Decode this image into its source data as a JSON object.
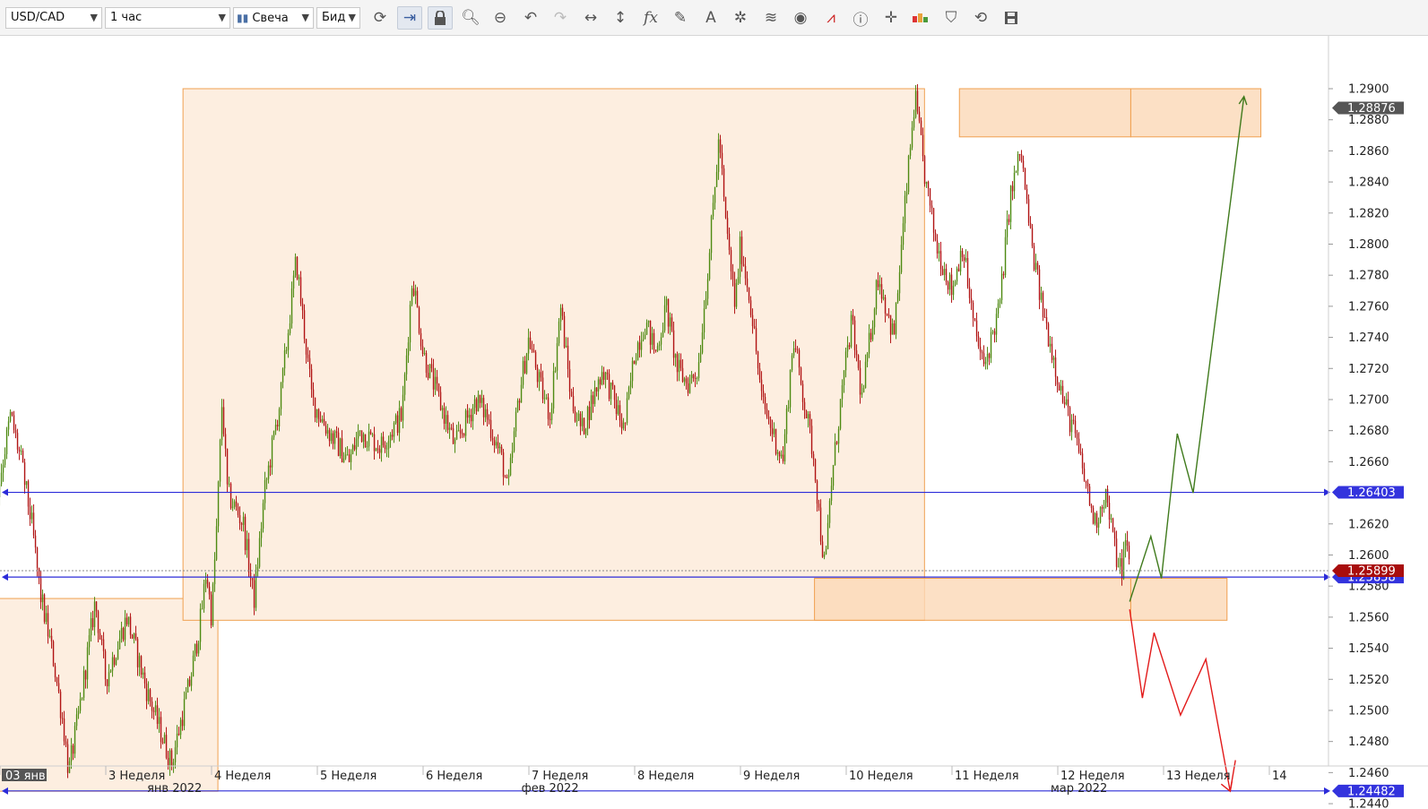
{
  "toolbar": {
    "symbol": "USD/CAD",
    "timeframe": "1 час",
    "chart_type": "Свеча",
    "price_side": "Бид",
    "icons": [
      "refresh-icon",
      "autoscroll-icon",
      "lock-icon",
      "zoom-in-icon",
      "zoom-out-icon",
      "undo-icon",
      "redo-icon",
      "horizontal-arrows-icon",
      "vertical-arrows-icon",
      "fx-icon",
      "pencil-icon",
      "text-tool-icon",
      "nodes-icon",
      "layers-icon",
      "eye-icon",
      "alert-chart-icon",
      "info-icon",
      "crosshair-icon",
      "heatmap-icon",
      "paint-bucket-icon",
      "circle-arrows-icon",
      "save-icon"
    ]
  },
  "colors": {
    "bull": "#4e8a12",
    "bear": "#b11414",
    "hline": "#2b2bd9",
    "zone_fill": "#fdeee0",
    "zone_stroke": "#f0a050",
    "zone_strong_fill": "#fbd8b6",
    "projection_up": "#3f7a1c",
    "projection_down": "#e21a1a",
    "current_badge": "#a80d0d",
    "level_badge": "#3333dd",
    "top_badge": "#555555"
  },
  "chart_data": {
    "type": "candlestick",
    "symbol": "USD/CAD",
    "timeframe": "1 час",
    "ylim": [
      1.2435,
      1.2912
    ],
    "y_ticks": [
      "1.2900",
      "1.2880",
      "1.2860",
      "1.2840",
      "1.2820",
      "1.2800",
      "1.2780",
      "1.2760",
      "1.2740",
      "1.2720",
      "1.2700",
      "1.2680",
      "1.2660",
      "1.2620",
      "1.2600",
      "1.2580",
      "1.2560",
      "1.2540",
      "1.2520",
      "1.2500",
      "1.2480",
      "1.2460",
      "1.2440"
    ],
    "x_week_labels": [
      {
        "label": "03 янв",
        "t": 0.0
      },
      {
        "label": "3 Неделя",
        "t": 1.0
      },
      {
        "label": "4 Неделя",
        "t": 2.0
      },
      {
        "label": "5 Неделя",
        "t": 3.0
      },
      {
        "label": "6 Неделя",
        "t": 4.0
      },
      {
        "label": "7 Неделя",
        "t": 5.0
      },
      {
        "label": "8 Неделя",
        "t": 6.0
      },
      {
        "label": "9 Неделя",
        "t": 7.0
      },
      {
        "label": "10 Неделя",
        "t": 8.0
      },
      {
        "label": "11 Неделя",
        "t": 9.0
      },
      {
        "label": "12 Неделя",
        "t": 10.0
      },
      {
        "label": "13 Неделя",
        "t": 11.0
      },
      {
        "label": "14",
        "t": 12.0
      }
    ],
    "x_month_labels": [
      {
        "label": "янв 2022",
        "t": 1.65
      },
      {
        "label": "фев 2022",
        "t": 5.2
      },
      {
        "label": "мар 2022",
        "t": 10.2
      }
    ],
    "price_path": [
      [
        -0.97,
        1.2665
      ],
      [
        -0.95,
        1.277
      ],
      [
        -0.8,
        1.272
      ],
      [
        -0.7,
        1.269
      ],
      [
        -0.62,
        1.276
      ],
      [
        -0.5,
        1.281
      ],
      [
        -0.4,
        1.272
      ],
      [
        -0.3,
        1.27
      ],
      [
        -0.15,
        1.264
      ],
      [
        -0.05,
        1.263
      ],
      [
        0.1,
        1.269
      ],
      [
        0.2,
        1.266
      ],
      [
        0.3,
        1.262
      ],
      [
        0.38,
        1.2575
      ],
      [
        0.5,
        1.2535
      ],
      [
        0.6,
        1.249
      ],
      [
        0.65,
        1.246
      ],
      [
        0.75,
        1.25
      ],
      [
        0.9,
        1.257
      ],
      [
        1.0,
        1.252
      ],
      [
        1.2,
        1.256
      ],
      [
        1.4,
        1.251
      ],
      [
        1.55,
        1.248
      ],
      [
        1.62,
        1.2465
      ],
      [
        1.7,
        1.249
      ],
      [
        1.8,
        1.252
      ],
      [
        1.9,
        1.256
      ],
      [
        1.95,
        1.259
      ],
      [
        2.0,
        1.256
      ],
      [
        2.05,
        1.262
      ],
      [
        2.1,
        1.27
      ],
      [
        2.15,
        1.264
      ],
      [
        2.3,
        1.262
      ],
      [
        2.4,
        1.257
      ],
      [
        2.5,
        1.264
      ],
      [
        2.65,
        1.27
      ],
      [
        2.75,
        1.276
      ],
      [
        2.8,
        1.279
      ],
      [
        2.85,
        1.276
      ],
      [
        2.95,
        1.27
      ],
      [
        3.1,
        1.268
      ],
      [
        3.3,
        1.266
      ],
      [
        3.4,
        1.268
      ],
      [
        3.6,
        1.267
      ],
      [
        3.8,
        1.269
      ],
      [
        3.9,
        1.278
      ],
      [
        4.0,
        1.273
      ],
      [
        4.2,
        1.269
      ],
      [
        4.3,
        1.267
      ],
      [
        4.5,
        1.27
      ],
      [
        4.6,
        1.269
      ],
      [
        4.75,
        1.266
      ],
      [
        4.8,
        1.264
      ],
      [
        4.9,
        1.27
      ],
      [
        5.0,
        1.274
      ],
      [
        5.1,
        1.271
      ],
      [
        5.2,
        1.269
      ],
      [
        5.3,
        1.276
      ],
      [
        5.4,
        1.27
      ],
      [
        5.5,
        1.268
      ],
      [
        5.6,
        1.27
      ],
      [
        5.7,
        1.272
      ],
      [
        5.8,
        1.27
      ],
      [
        5.9,
        1.268
      ],
      [
        6.0,
        1.273
      ],
      [
        6.1,
        1.275
      ],
      [
        6.2,
        1.273
      ],
      [
        6.3,
        1.276
      ],
      [
        6.4,
        1.272
      ],
      [
        6.5,
        1.271
      ],
      [
        6.6,
        1.272
      ],
      [
        6.7,
        1.279
      ],
      [
        6.8,
        1.287
      ],
      [
        6.85,
        1.282
      ],
      [
        6.95,
        1.276
      ],
      [
        7.0,
        1.28
      ],
      [
        7.1,
        1.276
      ],
      [
        7.2,
        1.27
      ],
      [
        7.3,
        1.268
      ],
      [
        7.4,
        1.266
      ],
      [
        7.5,
        1.274
      ],
      [
        7.6,
        1.27
      ],
      [
        7.7,
        1.266
      ],
      [
        7.75,
        1.262
      ],
      [
        7.8,
        1.259
      ],
      [
        7.85,
        1.264
      ],
      [
        7.95,
        1.27
      ],
      [
        8.05,
        1.275
      ],
      [
        8.15,
        1.27
      ],
      [
        8.3,
        1.278
      ],
      [
        8.45,
        1.274
      ],
      [
        8.55,
        1.282
      ],
      [
        8.65,
        1.2895
      ],
      [
        8.75,
        1.284
      ],
      [
        8.85,
        1.28
      ],
      [
        9.0,
        1.277
      ],
      [
        9.1,
        1.28
      ],
      [
        9.2,
        1.275
      ],
      [
        9.3,
        1.272
      ],
      [
        9.45,
        1.276
      ],
      [
        9.55,
        1.283
      ],
      [
        9.65,
        1.286
      ],
      [
        9.75,
        1.28
      ],
      [
        9.85,
        1.276
      ],
      [
        9.95,
        1.273
      ],
      [
        10.05,
        1.27
      ],
      [
        10.15,
        1.268
      ],
      [
        10.25,
        1.265
      ],
      [
        10.35,
        1.262
      ],
      [
        10.45,
        1.264
      ],
      [
        10.55,
        1.26
      ],
      [
        10.6,
        1.259
      ],
      [
        10.65,
        1.261
      ],
      [
        10.68,
        1.259
      ]
    ],
    "horizontal_levels": [
      {
        "value": 1.26403,
        "label": "1.26403"
      },
      {
        "value": 1.25858,
        "label": "1.25858"
      },
      {
        "value": 1.24482,
        "label": "1.24482"
      }
    ],
    "current_price": {
      "value": 1.25899,
      "label": "1.25899"
    },
    "top_price": {
      "value": 1.28876,
      "label": "1.28876"
    },
    "zones": [
      {
        "t0": -0.06,
        "t1": 2.06,
        "p0": 1.2448,
        "p1": 1.2572,
        "strong": false
      },
      {
        "t0": 1.73,
        "t1": 8.74,
        "p0": 1.2558,
        "p1": 1.29,
        "strong": false
      },
      {
        "t0": 9.07,
        "t1": 10.69,
        "p0": 1.2869,
        "p1": 1.29,
        "strong": true
      },
      {
        "t0": 10.69,
        "t1": 11.92,
        "p0": 1.2869,
        "p1": 1.29,
        "strong": true
      },
      {
        "t0": 7.7,
        "t1": 10.69,
        "p0": 1.2558,
        "p1": 1.2585,
        "strong": true
      },
      {
        "t0": 10.69,
        "t1": 11.6,
        "p0": 1.2558,
        "p1": 1.2585,
        "strong": true
      }
    ],
    "projection_up": [
      [
        10.68,
        1.257
      ],
      [
        10.88,
        1.2612
      ],
      [
        10.98,
        1.2585
      ],
      [
        11.13,
        1.2678
      ],
      [
        11.28,
        1.264
      ],
      [
        11.76,
        1.2895
      ]
    ],
    "projection_down": [
      [
        10.68,
        1.2565
      ],
      [
        10.8,
        1.2508
      ],
      [
        10.91,
        1.255
      ],
      [
        11.16,
        1.2497
      ],
      [
        11.4,
        1.2533
      ],
      [
        11.63,
        1.2448
      ],
      [
        11.68,
        1.2468
      ]
    ]
  }
}
